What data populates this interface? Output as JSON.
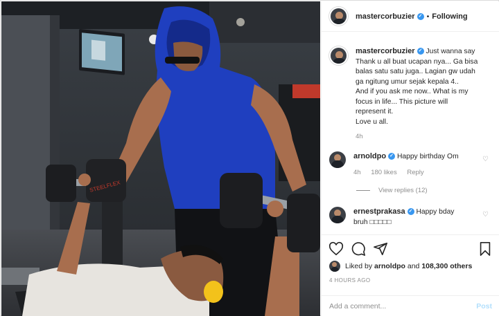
{
  "post": {
    "author": "mastercorbuzier",
    "follow_status": "Following",
    "caption_lines": [
      "Just wanna say",
      "Thank u all buat ucapan nya... Ga bisa",
      "balas satu satu juga.. Lagian gw udah",
      "ga ngitung umur sejak kepala 4.. ",
      "And if you ask me now.. What is my",
      "focus in life... This picture will",
      "represent it.",
      "Love u all."
    ],
    "caption_age": "4h"
  },
  "comments": [
    {
      "user": "arnoldpo",
      "text": "Happy birthday Om ",
      "age": "4h",
      "likes": "180 likes",
      "reply": "Reply",
      "view_replies": "View replies (12)"
    },
    {
      "user": "ernestprakasa",
      "text_line1": "Happy bday",
      "text_line2": "bruh □□□□□"
    }
  ],
  "engagement": {
    "liked_by_prefix": "Liked by",
    "liked_by_user": "arnoldpo",
    "and": "and",
    "others_count": "108,300 others",
    "time_ago": "4 HOURS AGO"
  },
  "composer": {
    "placeholder": "Add a comment...",
    "post_label": "Post"
  },
  "colors": {
    "verified": "#3897f0",
    "hoodie": "#1f3fbf",
    "post_disabled": "#b2dffc"
  },
  "icons": [
    "heart-icon",
    "comment-icon",
    "share-icon",
    "bookmark-icon",
    "verified-icon"
  ]
}
